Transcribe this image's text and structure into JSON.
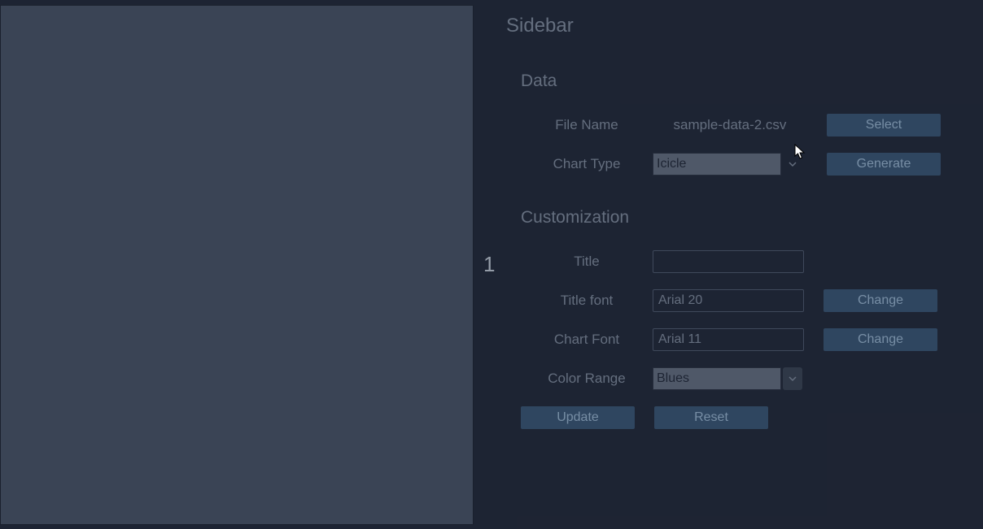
{
  "center_label": "1",
  "sidebar": {
    "title": "Sidebar",
    "data_section": {
      "title": "Data",
      "file_name_label": "File Name",
      "file_name_value": "sample-data-2.csv",
      "select_button": "Select",
      "chart_type_label": "Chart Type",
      "chart_type_value": "Icicle",
      "generate_button": "Generate"
    },
    "customization_section": {
      "title": "Customization",
      "title_label": "Title",
      "title_value": "",
      "title_font_label": "Title font",
      "title_font_value": "Arial 20",
      "title_font_button": "Change",
      "chart_font_label": "Chart Font",
      "chart_font_value": "Arial 11",
      "chart_font_button": "Change",
      "color_range_label": "Color Range",
      "color_range_value": "Blues",
      "update_button": "Update",
      "reset_button": "Reset"
    }
  }
}
